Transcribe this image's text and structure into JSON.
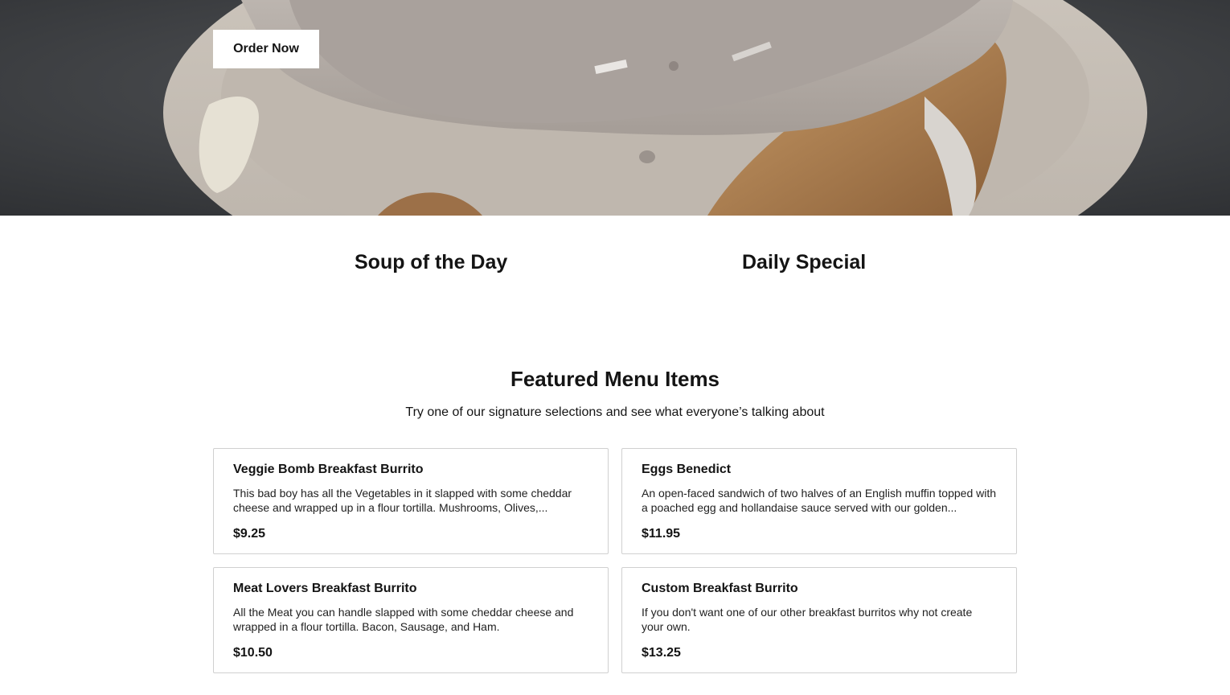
{
  "hero": {
    "order_button_label": "Order Now",
    "image": "cinnamon-roll-with-icing-photo"
  },
  "specials": {
    "soup_title": "Soup of the Day",
    "daily_title": "Daily Special"
  },
  "featured": {
    "title": "Featured Menu Items",
    "subtitle": "Try one of our signature selections and see what everyone’s talking about",
    "items": [
      {
        "name": "Veggie Bomb Breakfast Burrito",
        "description": "This bad boy has all the Vegetables in it slapped with some cheddar cheese and wrapped up in a flour tortilla. Mushrooms, Olives,...",
        "price": "$9.25"
      },
      {
        "name": "Eggs Benedict",
        "description": "An open-faced sandwich of two halves of an English muffin topped with a poached egg and hollandaise sauce served with our golden...",
        "price": "$11.95"
      },
      {
        "name": "Meat Lovers Breakfast Burrito",
        "description": "All the Meat you can handle slapped with some cheddar cheese and wrapped in a flour tortilla. Bacon, Sausage, and Ham.",
        "price": "$10.50"
      },
      {
        "name": "Custom Breakfast Burrito",
        "description": "If you don't want one of our other breakfast burritos why not create your own.",
        "price": "$13.25"
      }
    ]
  },
  "colors": {
    "text": "#141414",
    "card_border": "#d0d0d0",
    "hero_background": "#3b3d40",
    "plate": "#c9c2ba",
    "icing": "#b3aca6",
    "pastry": "#b88a5a"
  }
}
